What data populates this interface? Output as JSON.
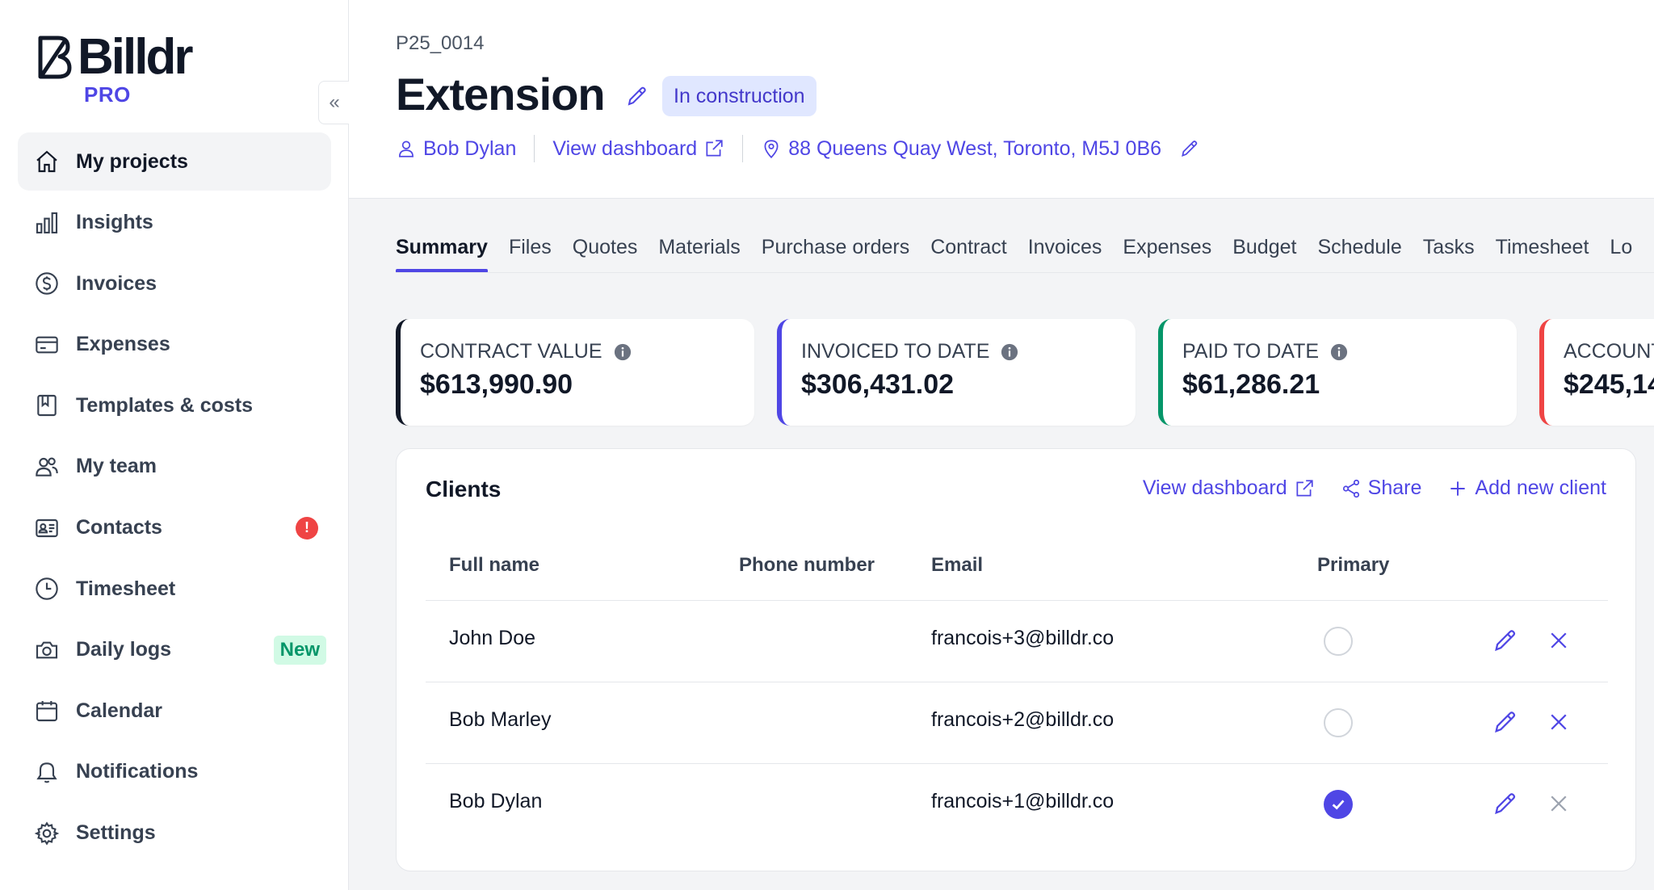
{
  "brand": {
    "name": "Billdr",
    "tier": "PRO"
  },
  "sidebar": {
    "items": [
      {
        "label": "My projects",
        "icon": "home-icon",
        "active": true
      },
      {
        "label": "Insights",
        "icon": "bar-chart-icon"
      },
      {
        "label": "Invoices",
        "icon": "dollar-circle-icon"
      },
      {
        "label": "Expenses",
        "icon": "credit-card-icon"
      },
      {
        "label": "Templates & costs",
        "icon": "bookmark-book-icon"
      },
      {
        "label": "My team",
        "icon": "users-icon"
      },
      {
        "label": "Contacts",
        "icon": "id-card-icon",
        "alert": "!"
      },
      {
        "label": "Timesheet",
        "icon": "clock-icon"
      },
      {
        "label": "Daily logs",
        "icon": "camera-icon",
        "badge": "New"
      },
      {
        "label": "Calendar",
        "icon": "calendar-icon"
      },
      {
        "label": "Notifications",
        "icon": "bell-icon"
      },
      {
        "label": "Settings",
        "icon": "gear-icon"
      }
    ]
  },
  "project": {
    "code": "P25_0014",
    "title": "Extension",
    "status": "In construction",
    "owner": "Bob Dylan",
    "view_dashboard": "View dashboard",
    "address": "88 Queens Quay West, Toronto, M5J 0B6"
  },
  "tabs": [
    "Summary",
    "Files",
    "Quotes",
    "Materials",
    "Purchase orders",
    "Contract",
    "Invoices",
    "Expenses",
    "Budget",
    "Schedule",
    "Tasks",
    "Timesheet",
    "Lo"
  ],
  "stats": [
    {
      "label": "CONTRACT VALUE",
      "value": "$613,990.90",
      "color": "#111827"
    },
    {
      "label": "INVOICED TO DATE",
      "value": "$306,431.02",
      "color": "#4f46e5"
    },
    {
      "label": "PAID TO DATE",
      "value": "$61,286.21",
      "color": "#059669"
    },
    {
      "label": "ACCOUNT",
      "value": "$245,14",
      "color": "#ef4444"
    }
  ],
  "clients": {
    "title": "Clients",
    "actions": {
      "view_dashboard": "View dashboard",
      "share": "Share",
      "add": "Add new client"
    },
    "columns": {
      "name": "Full name",
      "phone": "Phone number",
      "email": "Email",
      "primary": "Primary"
    },
    "rows": [
      {
        "name": "John Doe",
        "phone": "",
        "email": "francois+3@billdr.co",
        "primary": false
      },
      {
        "name": "Bob Marley",
        "phone": "",
        "email": "francois+2@billdr.co",
        "primary": false
      },
      {
        "name": "Bob Dylan",
        "phone": "",
        "email": "francois+1@billdr.co",
        "primary": true
      }
    ]
  },
  "colors": {
    "accent": "#4f46e5",
    "badge_bg": "#e0e7ff",
    "alert": "#ef4444",
    "new_badge": "#059669"
  }
}
